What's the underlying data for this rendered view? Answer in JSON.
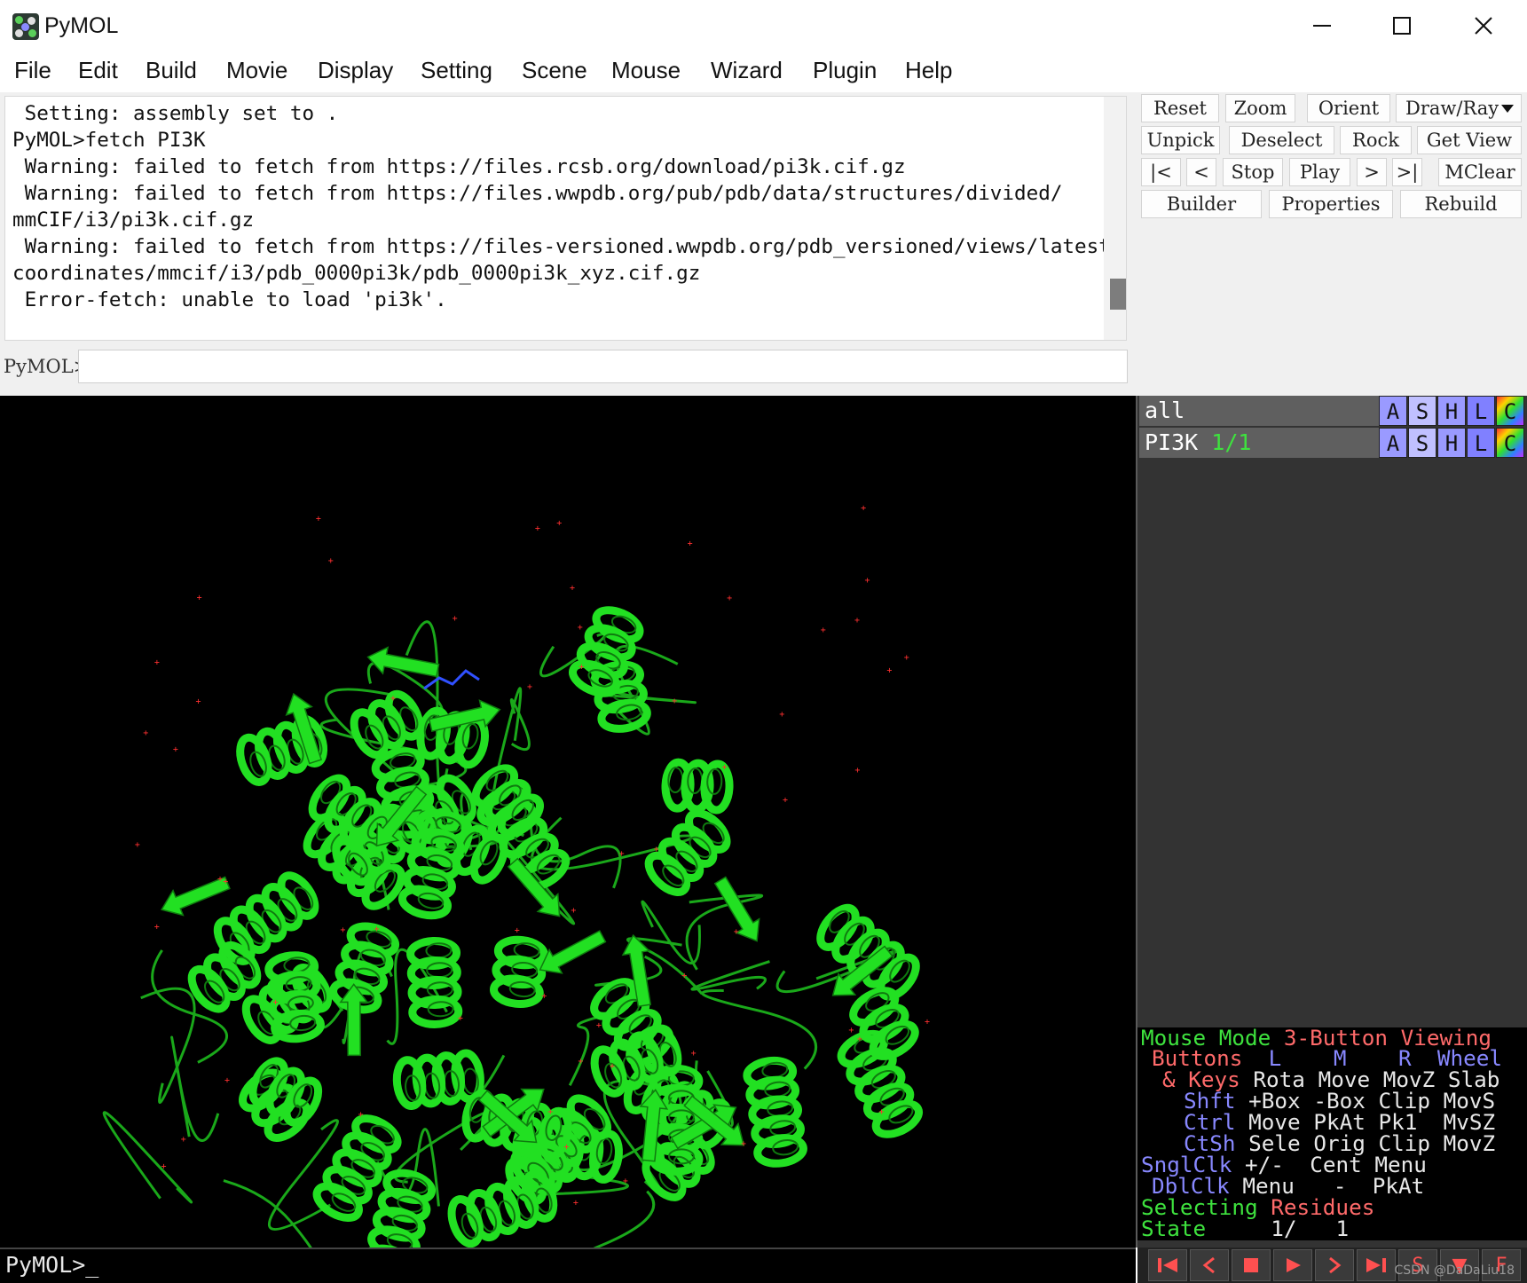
{
  "window": {
    "title": "PyMOL",
    "controls": {
      "minimize": "minimize-icon",
      "maximize": "maximize-icon",
      "close": "close-icon"
    }
  },
  "menubar": [
    "File",
    "Edit",
    "Build",
    "Movie",
    "Display",
    "Setting",
    "Scene",
    "Mouse",
    "Wizard",
    "Plugin",
    "Help"
  ],
  "console": {
    "lines": [
      " Setting: assembly set to .",
      "PyMOL>fetch PI3K",
      " Warning: failed to fetch from https://files.rcsb.org/download/pi3k.cif.gz",
      " Warning: failed to fetch from https://files.wwpdb.org/pub/pdb/data/structures/divided/",
      "mmCIF/i3/pi3k.cif.gz",
      " Warning: failed to fetch from https://files-versioned.wwpdb.org/pdb_versioned/views/latest/",
      "coordinates/mmcif/i3/pdb_0000pi3k/pdb_0000pi3k_xyz.cif.gz",
      " Error-fetch: unable to load 'pi3k'."
    ]
  },
  "command": {
    "label": "PyMOL>",
    "value": ""
  },
  "toolbar": {
    "row1": [
      "Reset",
      "Zoom",
      "Orient",
      "Draw/Ray"
    ],
    "row2": [
      "Unpick",
      "Deselect",
      "Rock",
      "Get View"
    ],
    "row3": [
      "|<",
      "<",
      "Stop",
      "Play",
      ">",
      ">|",
      "MClear"
    ],
    "row4": [
      "Builder",
      "Properties",
      "Rebuild"
    ]
  },
  "objects": [
    {
      "name": "all",
      "state": "",
      "buttons": [
        "A",
        "S",
        "H",
        "L",
        "C"
      ]
    },
    {
      "name": "PI3K",
      "state": "1/1",
      "buttons": [
        "A",
        "S",
        "H",
        "L",
        "C"
      ]
    }
  ],
  "object_button_colors": {
    "A": "#9a9aff",
    "S": "#c0c0ff",
    "H": "#9a9aff",
    "L": "#8080ff",
    "C": "rainbow"
  },
  "mouse_panel": {
    "mode_label": "Mouse Mode",
    "mode_value": "3-Button Viewing",
    "buttons_label": "Buttons",
    "col_L": "L",
    "col_M": "M",
    "col_R": "R",
    "col_Wheel": "Wheel",
    "keys_label": "& Keys",
    "keys_row": [
      "Rota",
      "Move",
      "MovZ",
      "Slab"
    ],
    "shft_label": "Shft",
    "shft_row": [
      "+Box",
      "-Box",
      "Clip",
      "MovS"
    ],
    "ctrl_label": "Ctrl",
    "ctrl_row": [
      "Move",
      "PkAt",
      "Pk1",
      "MvSZ"
    ],
    "ctsh_label": "CtSh",
    "ctsh_row": [
      "Sele",
      "Orig",
      "Clip",
      "MovZ"
    ],
    "snglclk_label": "SnglClk",
    "snglclk_row": [
      "+/-",
      "Cent",
      "Menu"
    ],
    "dblclk_label": "DblClk",
    "dblclk_row": [
      "Menu",
      "-",
      "PkAt"
    ],
    "selecting_label": "Selecting",
    "selecting_value": "Residues",
    "state_label": "State",
    "state_value": "1/",
    "state_total": "1"
  },
  "bottom_command": "PyMOL>_",
  "player_buttons": [
    "rewind-icon",
    "step-back-icon",
    "stop-icon",
    "play-icon",
    "step-forward-icon",
    "fast-forward-icon",
    "S",
    "▼",
    "F"
  ],
  "watermark": "CSDN @DaDaLiu18",
  "colors": {
    "cartoon": "#22e022",
    "background": "#000000",
    "panel": "#333333",
    "mode_green": "#3ee23e",
    "label_red": "#ff6a6a",
    "label_blue": "#8888ff"
  }
}
